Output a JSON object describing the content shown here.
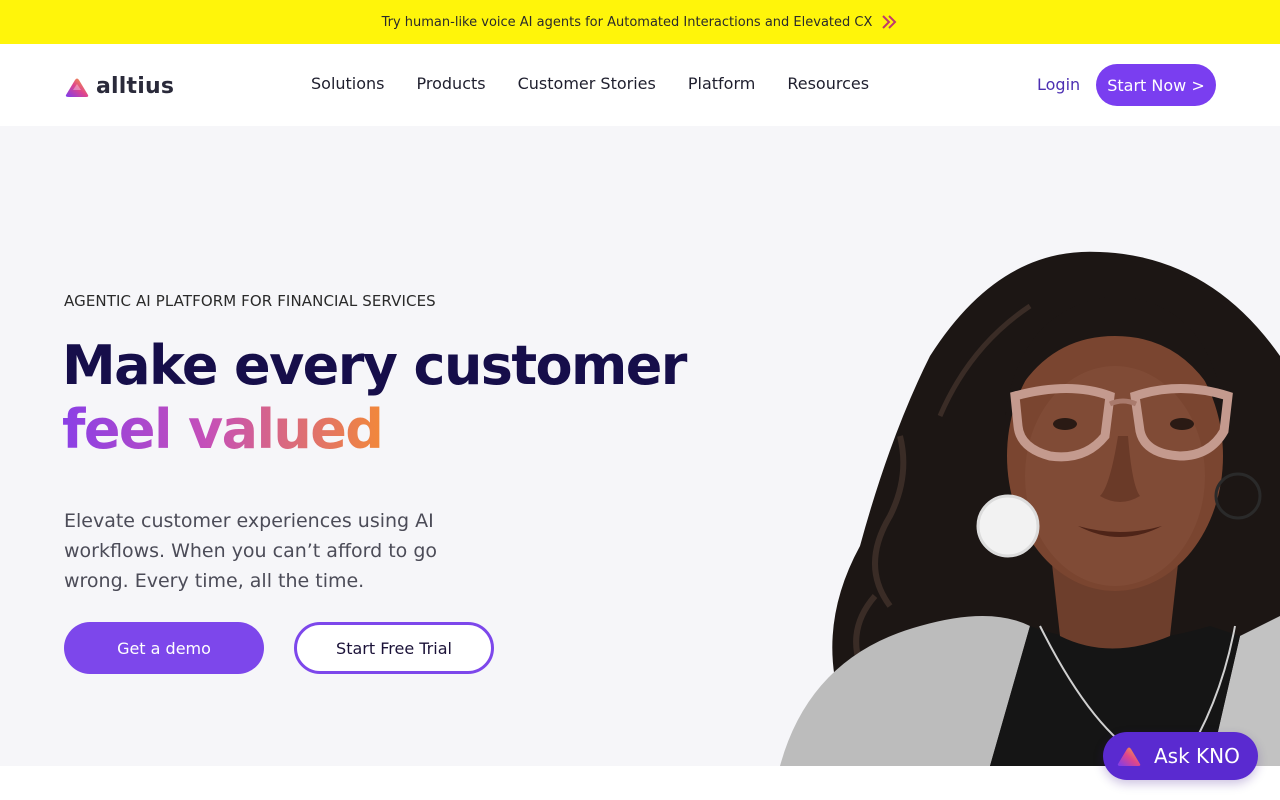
{
  "announcement": {
    "text": "Try human-like voice AI agents for Automated Interactions and Elevated CX",
    "icon": "double-chevron-right-icon"
  },
  "nav": {
    "logo_text": "alltius",
    "menu": [
      {
        "label": "Solutions"
      },
      {
        "label": "Products"
      },
      {
        "label": "Customer Stories"
      },
      {
        "label": "Platform"
      },
      {
        "label": "Resources"
      }
    ],
    "login_label": "Login",
    "start_now_label": "Start Now >"
  },
  "hero": {
    "eyebrow": "AGENTIC AI PLATFORM FOR FINANCIAL SERVICES",
    "headline": "Make every customer",
    "headline_accent": "feel valued",
    "subtext": "Elevate customer experiences using AI workflows. When you can’t afford to go wrong. Every time, all the time.",
    "demo_label": "Get a demo",
    "trial_label": "Start Free Trial"
  },
  "chat_widget": {
    "label": "Ask KNO"
  },
  "colors": {
    "announcement_bg": "#fff50a",
    "primary": "#7d47eb",
    "heading": "#160e4a",
    "hero_bg": "#f6f6f9"
  }
}
